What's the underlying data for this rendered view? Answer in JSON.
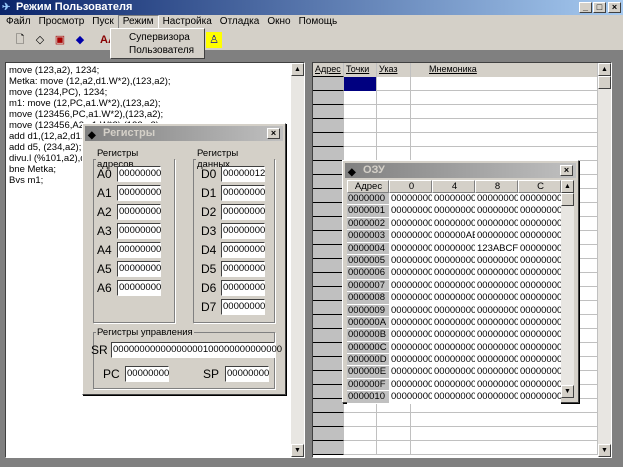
{
  "window": {
    "title": "Режим Пользователя",
    "icon": "satellite-icon"
  },
  "menu": [
    "Файл",
    "Просмотр",
    "Пуск",
    "Режим",
    "Настройка",
    "Отладка",
    "Окно",
    "Помощь"
  ],
  "toolbar": [
    "new-file-icon",
    "open-icon",
    "save-icon",
    "erase-icon",
    "font-icon",
    "run-icon"
  ],
  "toolbar_font_label": "AA",
  "dropdown": {
    "items": [
      "Супервизора",
      "Пользователя"
    ]
  },
  "editor": {
    "text": "move (123,a2), 1234;\nMetka: move (12,a2,d1.W*2),(123,a2);\nmove (1234,PC), 1234;\nm1: move (12,PC,a1.W*2),(123,a2);\nmove (123456,PC,a1.W*2),(123,a2);\nmove (123456,A2,a1.W*2),(123,a2);\nadd d1,(12,a2,d1.L*\nadd d5, (234,a2);\ndivu.l (%101,a2),d1:\nbne Metka;\nBvs m1;"
  },
  "grid": {
    "columns": [
      "Адрес",
      "Точки",
      "Указ",
      "Мнемоника"
    ],
    "selected_color": "#000080"
  },
  "registers": {
    "title": "Регистры",
    "address_group": "Регистры адресов",
    "data_group": "Регистры данных",
    "control_group": "Регистры управления",
    "address": [
      {
        "name": "A0",
        "value": "00000000"
      },
      {
        "name": "A1",
        "value": "00000000"
      },
      {
        "name": "A2",
        "value": "00000000"
      },
      {
        "name": "A3",
        "value": "00000000"
      },
      {
        "name": "A4",
        "value": "00000000"
      },
      {
        "name": "A5",
        "value": "00000000"
      },
      {
        "name": "A6",
        "value": "00000000"
      }
    ],
    "data": [
      {
        "name": "D0",
        "value": "00000012"
      },
      {
        "name": "D1",
        "value": "00000000"
      },
      {
        "name": "D2",
        "value": "00000000"
      },
      {
        "name": "D3",
        "value": "00000000"
      },
      {
        "name": "D4",
        "value": "00000000"
      },
      {
        "name": "D5",
        "value": "00000000"
      },
      {
        "name": "D6",
        "value": "00000000"
      },
      {
        "name": "D7",
        "value": "00000000"
      }
    ],
    "sr": {
      "name": "SR",
      "value": "00000000000000000100000000000000"
    },
    "pc": {
      "name": "PC",
      "value": "00000000"
    },
    "sp": {
      "name": "SP",
      "value": "00000000"
    }
  },
  "ram": {
    "title": "ОЗУ",
    "columns": [
      "Адрес",
      "0",
      "4",
      "8",
      "C"
    ],
    "rows": [
      [
        "0000000",
        "00000000",
        "00000000",
        "00000000",
        "00000000"
      ],
      [
        "0000001",
        "00000000",
        "00000000",
        "00000000",
        "00000000"
      ],
      [
        "0000002",
        "00000000",
        "00000000",
        "00000000",
        "00000000"
      ],
      [
        "0000003",
        "00000000",
        "000000AB",
        "00000000",
        "00000000"
      ],
      [
        "0000004",
        "00000000",
        "00000000",
        "123ABCF",
        "00000000"
      ],
      [
        "0000005",
        "00000000",
        "00000000",
        "00000000",
        "00000000"
      ],
      [
        "0000006",
        "00000000",
        "00000000",
        "00000000",
        "00000000"
      ],
      [
        "0000007",
        "00000000",
        "00000000",
        "00000000",
        "00000000"
      ],
      [
        "0000008",
        "00000000",
        "00000000",
        "00000000",
        "00000000"
      ],
      [
        "0000009",
        "00000000",
        "00000000",
        "00000000",
        "00000000"
      ],
      [
        "000000A",
        "00000000",
        "00000000",
        "00000000",
        "00000000"
      ],
      [
        "000000B",
        "00000000",
        "00000000",
        "00000000",
        "00000000"
      ],
      [
        "000000C",
        "00000000",
        "00000000",
        "00000000",
        "00000000"
      ],
      [
        "000000D",
        "00000000",
        "00000000",
        "00000000",
        "00000000"
      ],
      [
        "000000E",
        "00000000",
        "00000000",
        "00000000",
        "00000000"
      ],
      [
        "000000F",
        "00000000",
        "00000000",
        "00000000",
        "00000000"
      ],
      [
        "0000010",
        "00000000",
        "00000000",
        "00000000",
        "00000000"
      ]
    ]
  }
}
